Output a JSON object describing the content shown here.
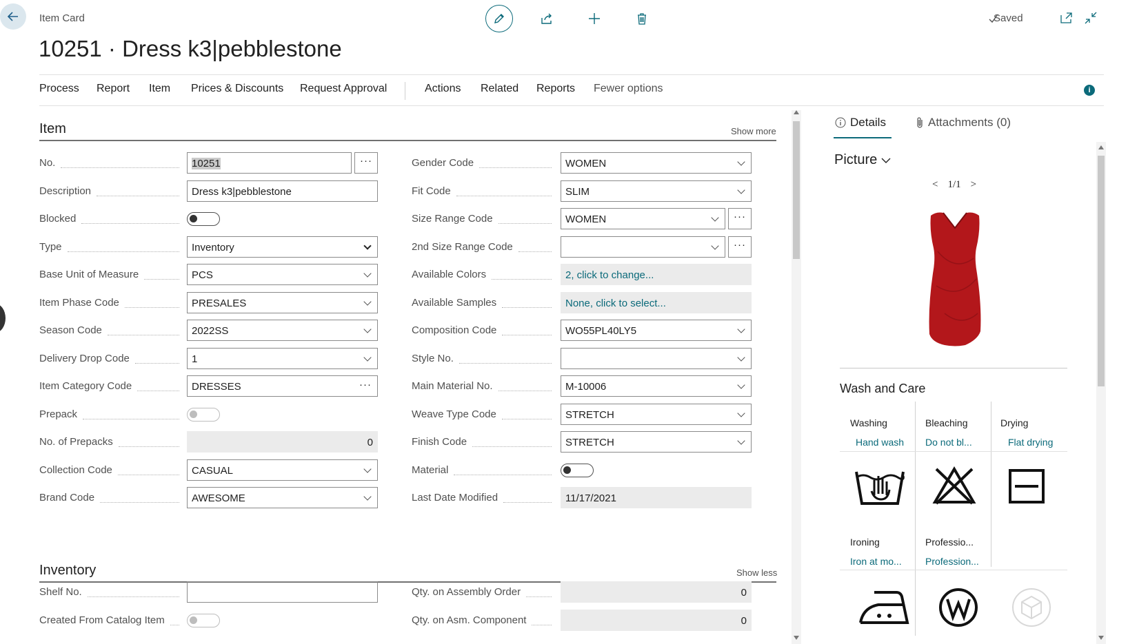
{
  "header": {
    "breadcrumb": "Item Card",
    "title": "10251 · Dress k3|pebblestone",
    "saved": "Saved"
  },
  "menu": [
    "Process",
    "Report",
    "Item",
    "Prices & Discounts",
    "Request Approval",
    "Actions",
    "Related",
    "Reports",
    "Fewer options"
  ],
  "item": {
    "heading": "Item",
    "show_more": "Show more",
    "left": [
      {
        "label": "No.",
        "value": "10251"
      },
      {
        "label": "Description",
        "value": "Dress k3|pebblestone"
      },
      {
        "label": "Blocked",
        "value": ""
      },
      {
        "label": "Type",
        "value": "Inventory"
      },
      {
        "label": "Base Unit of Measure",
        "value": "PCS"
      },
      {
        "label": "Item Phase Code",
        "value": "PRESALES"
      },
      {
        "label": "Season Code",
        "value": "2022SS"
      },
      {
        "label": "Delivery Drop Code",
        "value": "1"
      },
      {
        "label": "Item Category Code",
        "value": "DRESSES"
      },
      {
        "label": "Prepack",
        "value": ""
      },
      {
        "label": "No. of Prepacks",
        "value": "0"
      },
      {
        "label": "Collection Code",
        "value": "CASUAL"
      },
      {
        "label": "Brand Code",
        "value": "AWESOME"
      }
    ],
    "right": [
      {
        "label": "Gender Code",
        "value": "WOMEN"
      },
      {
        "label": "Fit Code",
        "value": "SLIM"
      },
      {
        "label": "Size Range Code",
        "value": "WOMEN"
      },
      {
        "label": "2nd Size Range Code",
        "value": ""
      },
      {
        "label": "Available Colors",
        "value": "2, click to change..."
      },
      {
        "label": "Available Samples",
        "value": "None, click to select..."
      },
      {
        "label": "Composition Code",
        "value": "WO55PL40LY5"
      },
      {
        "label": "Style No.",
        "value": ""
      },
      {
        "label": "Main Material No.",
        "value": "M-10006"
      },
      {
        "label": "Weave Type Code",
        "value": "STRETCH"
      },
      {
        "label": "Finish Code",
        "value": "STRETCH"
      },
      {
        "label": "Material",
        "value": ""
      },
      {
        "label": "Last Date Modified",
        "value": "11/17/2021"
      }
    ]
  },
  "inventory": {
    "heading": "Inventory",
    "show_less": "Show less",
    "left": [
      {
        "label": "Shelf No.",
        "value": ""
      },
      {
        "label": "Created From Catalog Item",
        "value": ""
      }
    ],
    "right": [
      {
        "label": "Qty. on Assembly Order",
        "value": "0"
      },
      {
        "label": "Qty. on Asm. Component",
        "value": "0"
      }
    ]
  },
  "factbox": {
    "tab_details": "Details",
    "tab_attachments": "Attachments (0)",
    "picture": "Picture",
    "pager": "1/1",
    "wash_title": "Wash and Care",
    "care": [
      {
        "h": "Washing",
        "v": "Hand wash"
      },
      {
        "h": "Bleaching",
        "v": "Do not bl..."
      },
      {
        "h": "Drying",
        "v": "Flat drying"
      },
      {
        "h": "Ironing",
        "v": "Iron at mo..."
      },
      {
        "h": "Professio...",
        "v": "Profession..."
      }
    ]
  },
  "colors": {
    "accent": "#0b6a7a",
    "dress": "#b3171b"
  }
}
